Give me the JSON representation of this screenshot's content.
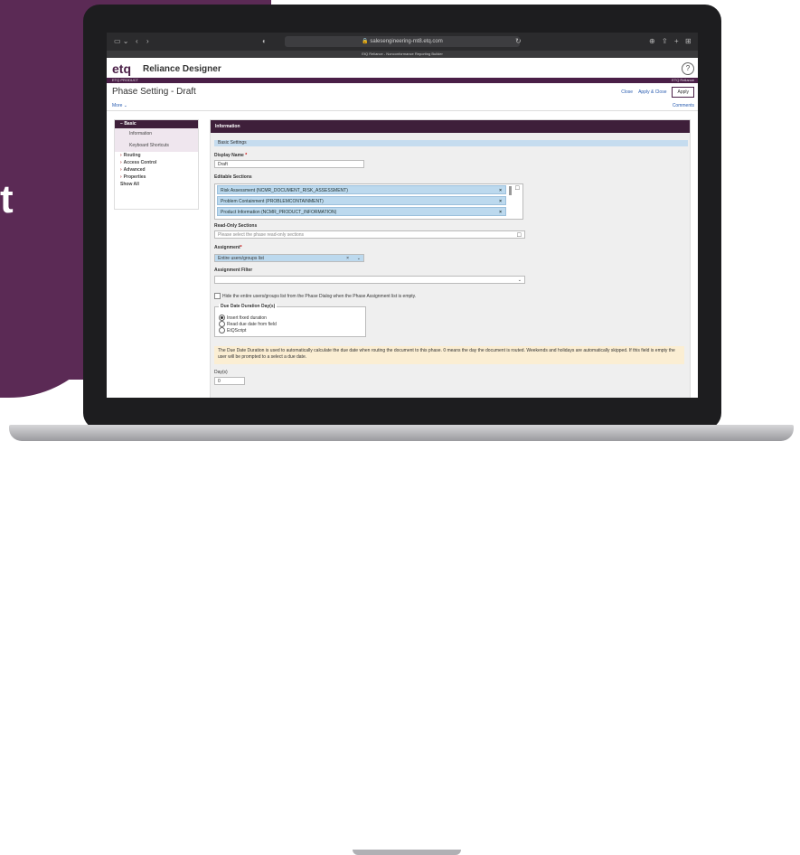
{
  "background": {
    "left_text": "t",
    "accent": "#5b2a55"
  },
  "browser": {
    "url": "salesengineering-mt8.etq.com",
    "tab_title": "EtQ Reliance - Nonconformance Reporting Builder"
  },
  "app": {
    "logo": "etq",
    "title": "Reliance Designer",
    "product_left": "ETQ PRODUCT",
    "product_right": "ETQ Reliance"
  },
  "page": {
    "title": "Phase Setting - Draft",
    "more_label": "More ⌄",
    "comments_label": "Comments",
    "close_label": "Close",
    "apply_close_label": "Apply & Close",
    "apply_label": "Apply"
  },
  "sidebar": {
    "items": [
      {
        "label": "Basic",
        "type": "header"
      },
      {
        "label": "Information",
        "type": "sub"
      },
      {
        "label": "Keyboard Shortcuts",
        "type": "sub"
      },
      {
        "label": "Routing",
        "type": "item"
      },
      {
        "label": "Access Control",
        "type": "item"
      },
      {
        "label": "Advanced",
        "type": "item"
      },
      {
        "label": "Properties",
        "type": "item"
      },
      {
        "label": "Show All",
        "type": "plain"
      }
    ]
  },
  "panel": {
    "header": "Information",
    "section": "Basic Settings",
    "display_name_label": "Display Name",
    "display_name_value": "Draft",
    "editable_label": "Editable Sections",
    "editable_items": [
      "Risk Assessment (NCMR_DOCUMENT_RISK_ASSESSMENT)",
      "Problem Containment (PROBLEMCONTAINMENT)",
      "Product Information (NCMR_PRODUCT_INFORMATION)"
    ],
    "readonly_label": "Read-Only Sections",
    "readonly_placeholder": "Please select the phase read-only sections",
    "assignment_label": "Assignment",
    "assignment_value": "Entire users/groups list",
    "assignment_filter_label": "Assignment Filter",
    "hide_checkbox_label": "Hide the entire users/groups list from the Phase Dialog when the Phase Assignment list is empty.",
    "due_legend": "Due Date Duration Day(s)",
    "due_options": [
      "Insert fixed duration",
      "Read due date from field",
      "EtQScript"
    ],
    "note": "The Due Date Duration is used to automatically calculate the due date when routing the document to this phase. 0 means the day the document is routed. Weekends and holidays are automatically skipped. If this field is empty the user will be prompted to a select a due date.",
    "days_label": "Day(s)",
    "days_value": "0"
  }
}
